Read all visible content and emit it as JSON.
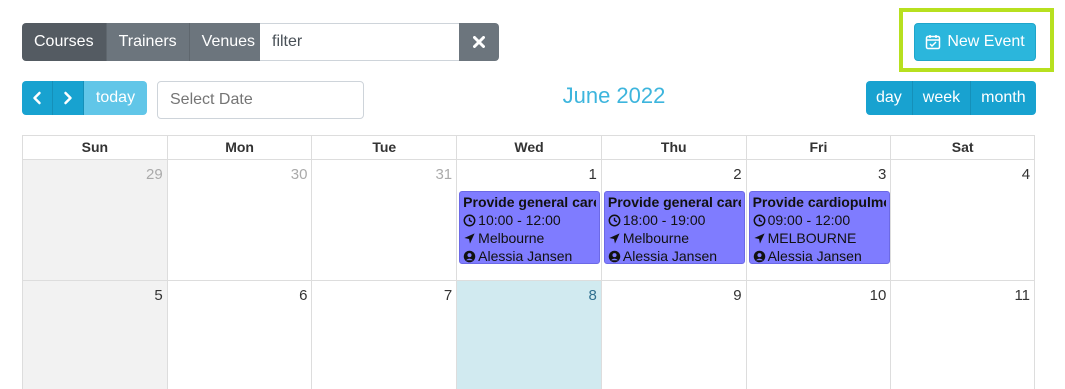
{
  "toolbar": {
    "segments": [
      "Courses",
      "Trainers",
      "Venues"
    ],
    "filter_value": "filter",
    "new_event_label": "New Event"
  },
  "nav": {
    "today_label": "today",
    "date_placeholder": "Select Date",
    "month_title": "June 2022",
    "views": [
      "day",
      "week",
      "month"
    ]
  },
  "calendar": {
    "weekdays": [
      "Sun",
      "Mon",
      "Tue",
      "Wed",
      "Thu",
      "Fri",
      "Sat"
    ],
    "week1": [
      "29",
      "30",
      "31",
      "1",
      "2",
      "3",
      "4"
    ],
    "week2": [
      "5",
      "6",
      "7",
      "8",
      "9",
      "10",
      "11"
    ],
    "events": [
      {
        "title": "Provide general care or",
        "time": "10:00 - 12:00",
        "location": "Melbourne",
        "trainer": "Alessia Jansen"
      },
      {
        "title": "Provide general care or",
        "time": "18:00 - 19:00",
        "location": "Melbourne",
        "trainer": "Alessia Jansen"
      },
      {
        "title": "Provide cardiopulmonar",
        "time": "09:00 - 12:00",
        "location": "MELBOURNE",
        "trainer": "Alessia Jansen"
      }
    ]
  },
  "colors": {
    "accent": "#18a2d0",
    "month_title": "#3db5dd",
    "event_bg": "#7f7cff",
    "highlight": "#b7e01f",
    "today_bg": "#d1eaf0"
  }
}
